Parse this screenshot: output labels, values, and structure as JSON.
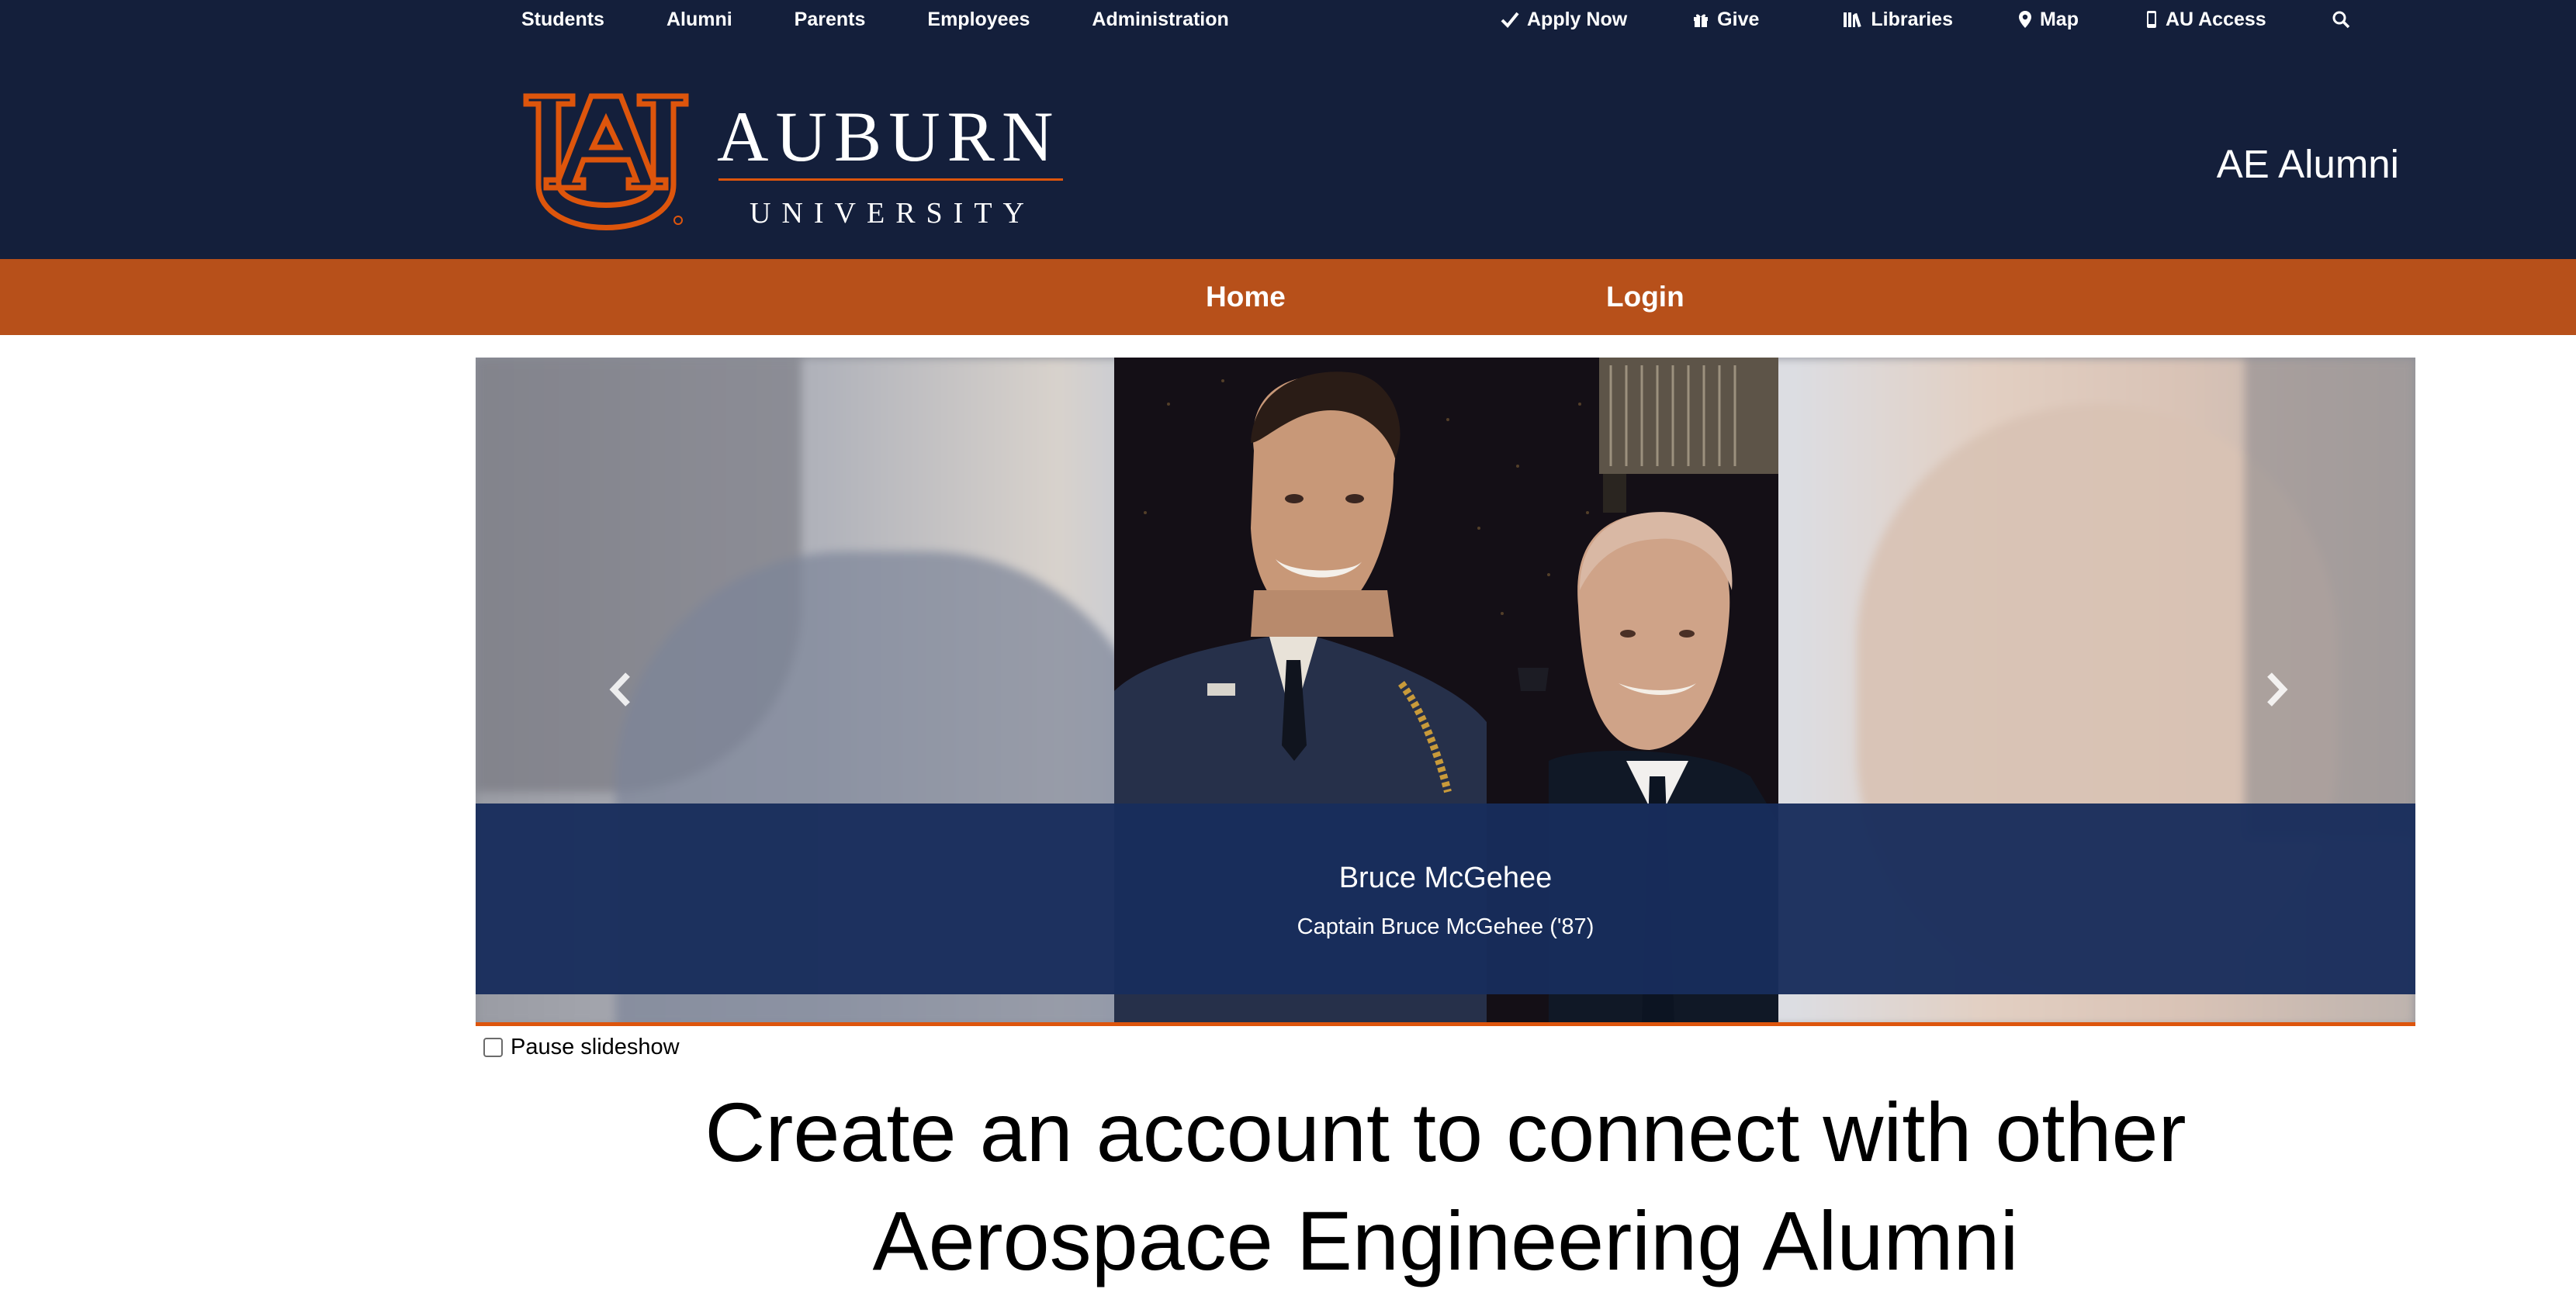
{
  "utility_nav": {
    "left_links": [
      "Students",
      "Alumni",
      "Parents",
      "Employees",
      "Administration"
    ],
    "apply_label": "Apply Now",
    "give_label": "Give",
    "libraries_label": "Libraries",
    "map_label": "Map",
    "au_access_label": "AU Access"
  },
  "logo": {
    "wordmark": "AUBURN",
    "subtitle": "UNIVERSITY"
  },
  "site_title": "AE Alumni",
  "main_nav": {
    "home": "Home",
    "login": "Login"
  },
  "slideshow": {
    "caption_title": "Bruce McGehee",
    "caption_text": "Captain Bruce McGehee ('87)",
    "pause_label": "Pause slideshow",
    "pause_checked": false
  },
  "headline": "Create an account to connect with other Aerospace Engineering Alumni",
  "colors": {
    "navy": "#141f3b",
    "orange": "#b7501a",
    "accent": "#dd550c",
    "caption_bg": "#182d5c"
  }
}
